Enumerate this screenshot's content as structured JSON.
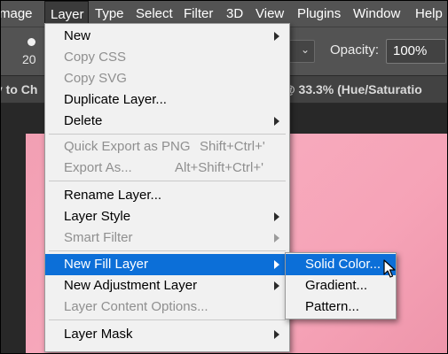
{
  "colors": {
    "menubar_bg": "#535353",
    "menu_bg": "#f1f1f1",
    "highlight": "#0c6fd8",
    "canvas_pink": "#f6a3b7"
  },
  "menubar": {
    "items": [
      "mage",
      "Layer",
      "Type",
      "Select",
      "Filter",
      "3D",
      "View",
      "Plugins",
      "Window",
      "Help"
    ],
    "active": "Layer"
  },
  "options": {
    "brush_size": "20",
    "opacity_label": "Opacity:",
    "opacity_value": "100%"
  },
  "document": {
    "tab_left": "y to Ch",
    "tab_right": "@ 33.3% (Hue/Saturatio"
  },
  "layer_menu": {
    "items": [
      {
        "label": "New",
        "disabled": false,
        "submenu": true
      },
      {
        "label": "Copy CSS",
        "disabled": true
      },
      {
        "label": "Copy SVG",
        "disabled": true
      },
      {
        "label": "Duplicate Layer...",
        "disabled": false
      },
      {
        "label": "Delete",
        "disabled": false,
        "submenu": true
      },
      {
        "label": "Quick Export as PNG",
        "shortcut": "Shift+Ctrl+'",
        "disabled": true
      },
      {
        "label": "Export As...",
        "shortcut": "Alt+Shift+Ctrl+'",
        "disabled": true
      },
      {
        "label": "Rename Layer...",
        "disabled": false
      },
      {
        "label": "Layer Style",
        "disabled": false,
        "submenu": true
      },
      {
        "label": "Smart Filter",
        "disabled": true,
        "submenu": true
      },
      {
        "label": "New Fill Layer",
        "disabled": false,
        "submenu": true,
        "highlighted": true
      },
      {
        "label": "New Adjustment Layer",
        "disabled": false,
        "submenu": true
      },
      {
        "label": "Layer Content Options...",
        "disabled": true
      },
      {
        "label": "Layer Mask",
        "disabled": false,
        "submenu": true
      }
    ]
  },
  "fill_submenu": {
    "items": [
      {
        "label": "Solid Color...",
        "highlighted": true
      },
      {
        "label": "Gradient..."
      },
      {
        "label": "Pattern..."
      }
    ]
  },
  "icons": {
    "submenu_arrow": "triangle-right-icon",
    "brush_preview": "brush-tip-icon",
    "dropdown": "chevron-down-icon",
    "cursor": "mouse-pointer-icon"
  }
}
